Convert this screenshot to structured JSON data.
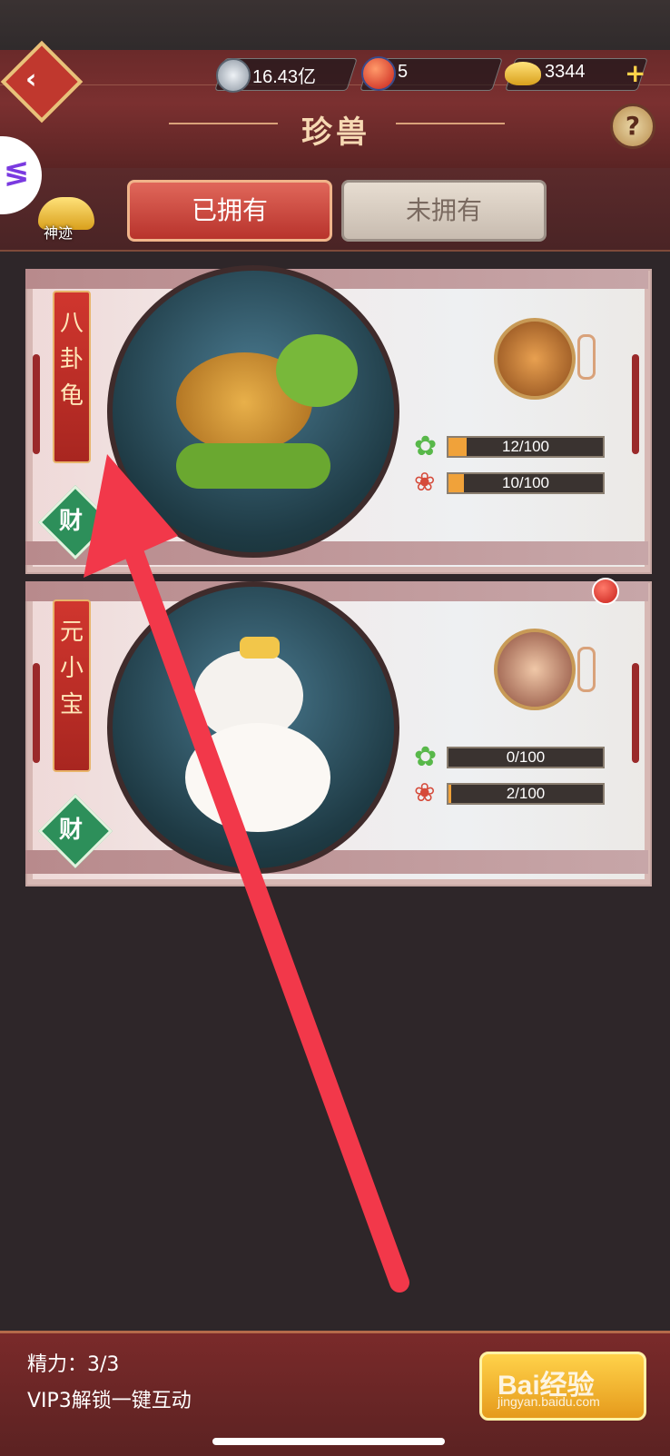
{
  "header": {
    "title": "珍兽",
    "resources": [
      {
        "icon": "silver-coin-icon",
        "value": "16.43亿"
      },
      {
        "icon": "red-orb-icon",
        "value": "5"
      },
      {
        "icon": "gold-ingot-icon",
        "value": "3344"
      }
    ],
    "shenji_label": "神迹"
  },
  "tabs": [
    {
      "label": "已拥有",
      "active": true
    },
    {
      "label": "未拥有",
      "active": false
    }
  ],
  "pets": [
    {
      "name": "八卦龟",
      "badge": "财",
      "stat1": {
        "icon": "clover-icon",
        "current": 12,
        "max": 100,
        "text": "12/100"
      },
      "stat2": {
        "icon": "paw-icon",
        "current": 10,
        "max": 100,
        "text": "10/100"
      },
      "has_notification": false
    },
    {
      "name": "元小宝",
      "badge": "财",
      "stat1": {
        "icon": "clover-icon",
        "current": 0,
        "max": 100,
        "text": "0/100"
      },
      "stat2": {
        "icon": "paw-icon",
        "current": 2,
        "max": 100,
        "text": "2/100"
      },
      "has_notification": true
    }
  ],
  "footer": {
    "energy": "精力：3/3",
    "vip_text": "VIP3解锁一键互动",
    "watermark": "Bai经验",
    "watermark_url": "jingyan.baidu.com"
  },
  "colors": {
    "accent_red": "#c0382e",
    "gold": "#f0a23a",
    "arrow": "#f2384a"
  }
}
